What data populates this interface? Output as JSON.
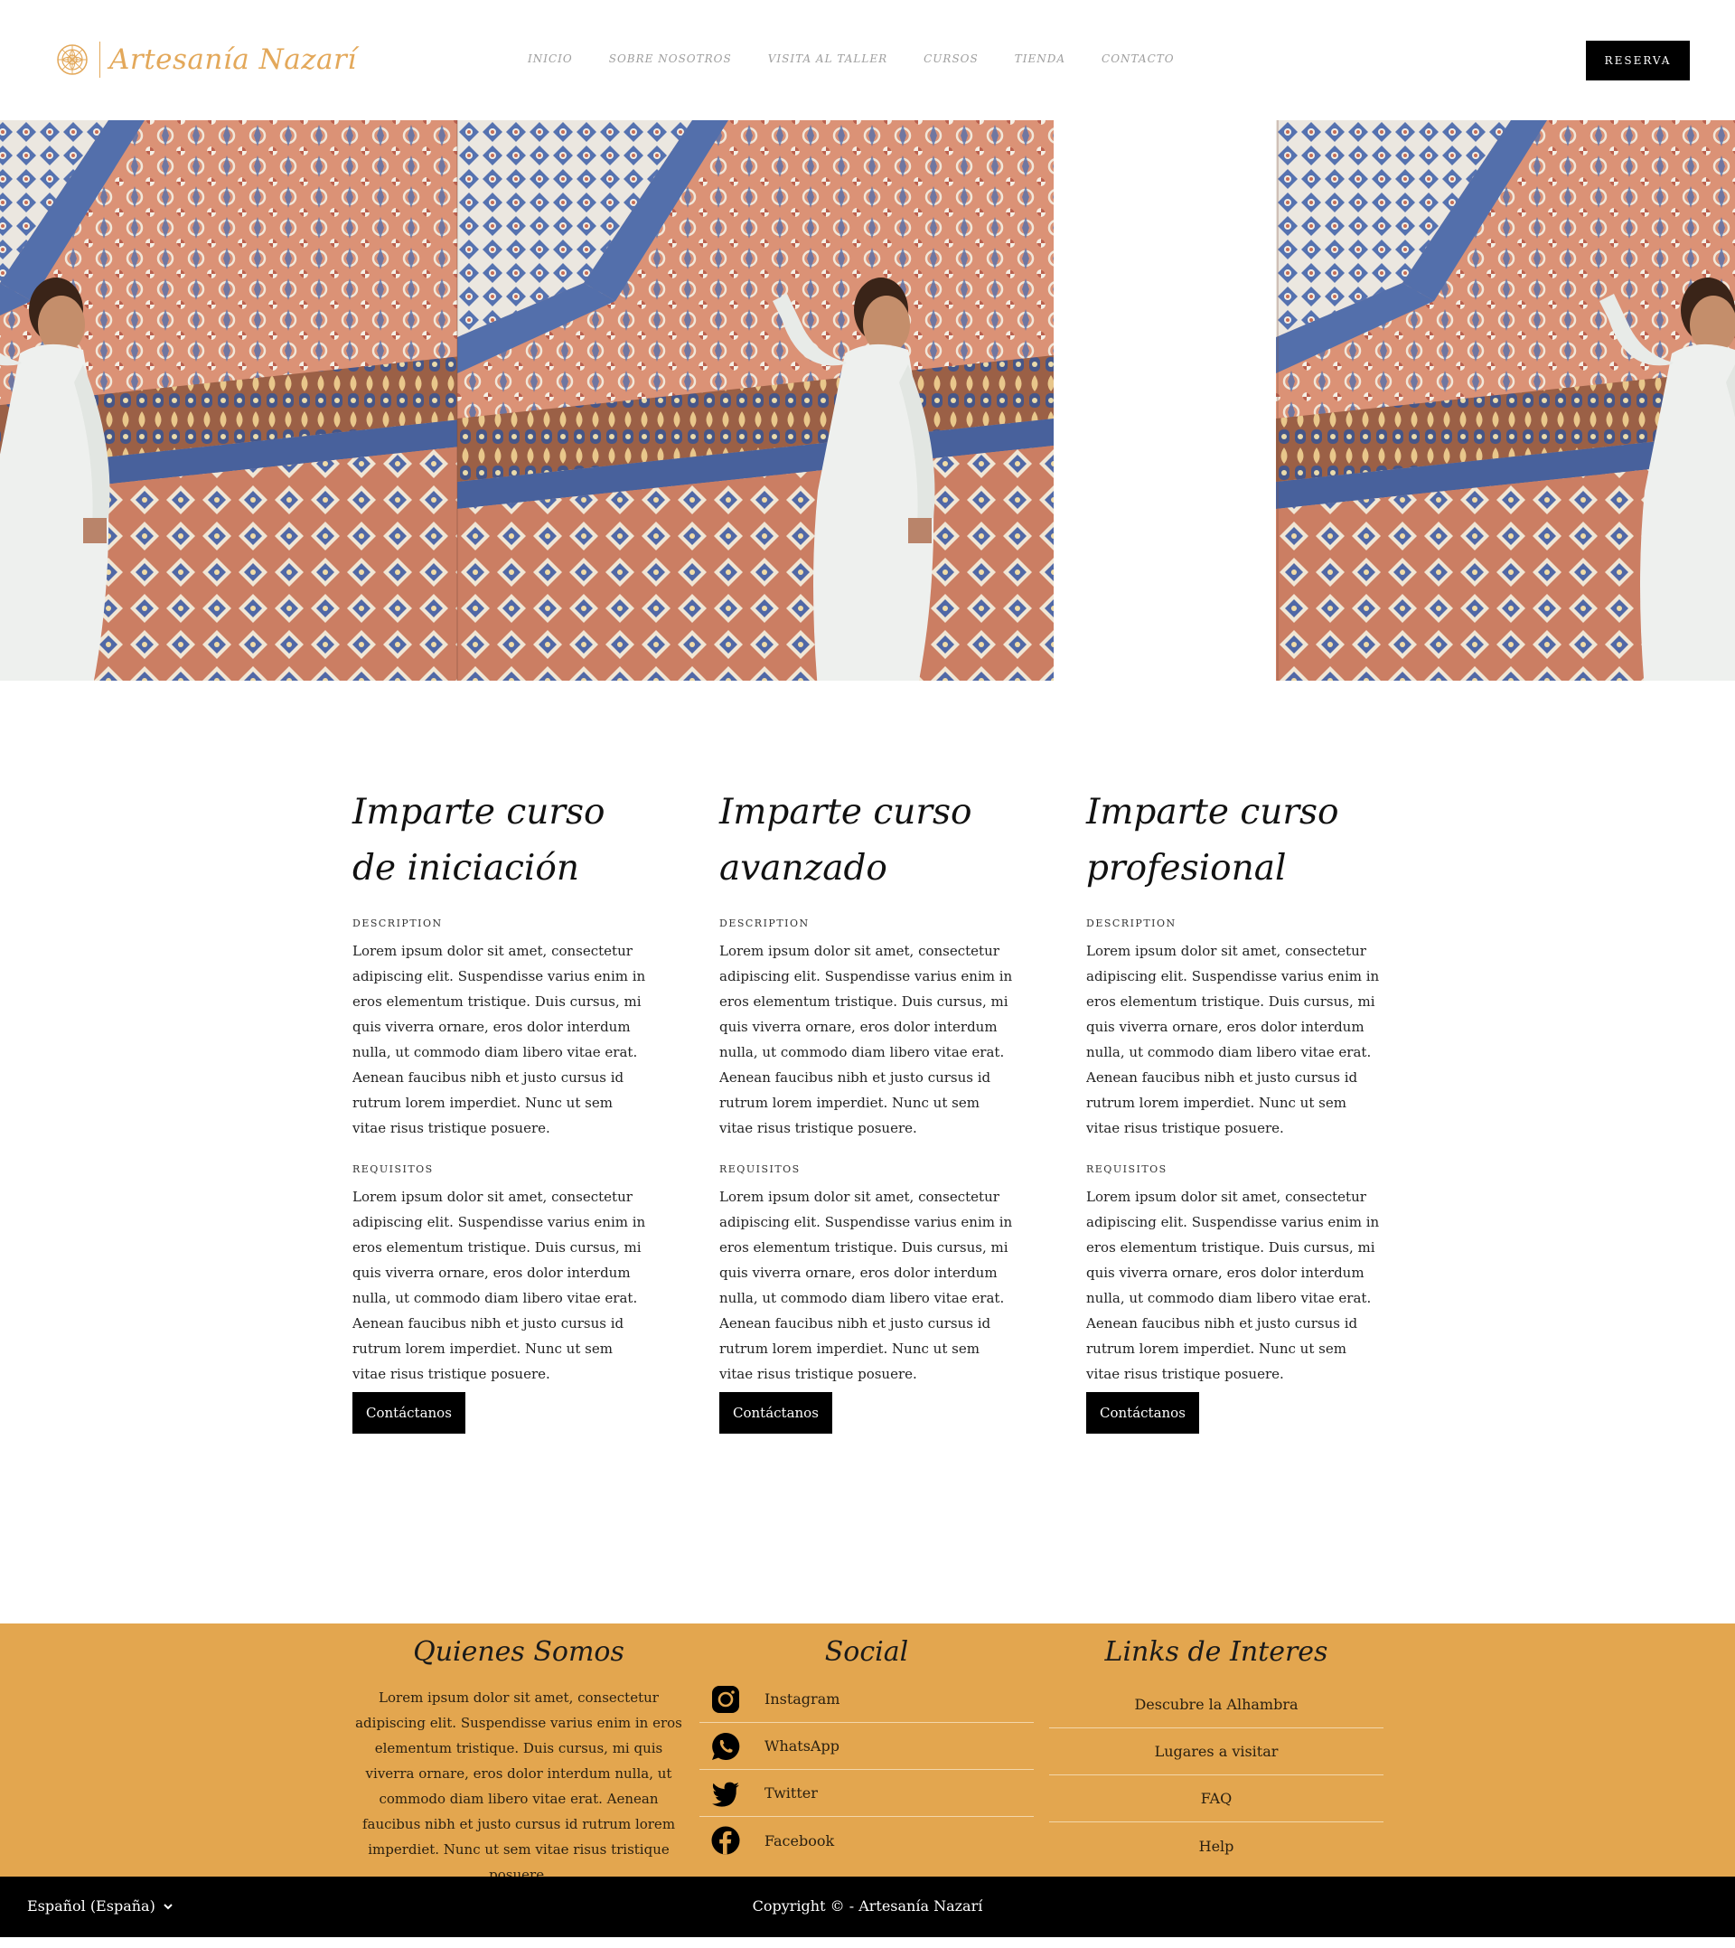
{
  "brand": {
    "name": "Artesanía Nazarí",
    "icon": "mandala-logo-icon",
    "accent": "#e3a85a"
  },
  "nav": {
    "items": [
      "INICIO",
      "SOBRE NOSOTROS",
      "VISITA AL TALLER",
      "CURSOS",
      "TIENDA",
      "CONTACTO"
    ],
    "cta": "RESERVA"
  },
  "courses": [
    {
      "title": "Imparte curso de iniciación",
      "description_label": "DESCRIPTION",
      "description": "Lorem ipsum dolor sit amet, consectetur adipiscing elit. Suspendisse varius enim in eros elementum tristique. Duis cursus, mi quis viverra ornare, eros dolor interdum nulla, ut commodo diam libero vitae erat. Aenean faucibus nibh et justo cursus id rutrum lorem imperdiet. Nunc ut sem vitae risus tristique posuere.",
      "requirements_label": "REQUISITOS",
      "requirements": "Lorem ipsum dolor sit amet, consectetur adipiscing elit. Suspendisse varius enim in eros elementum tristique. Duis cursus, mi quis viverra ornare, eros dolor interdum nulla, ut commodo diam libero vitae erat. Aenean faucibus nibh et justo cursus id rutrum lorem imperdiet. Nunc ut sem vitae risus tristique posuere.",
      "button": "Contáctanos"
    },
    {
      "title": "Imparte curso avanzado",
      "description_label": "DESCRIPTION",
      "description": "Lorem ipsum dolor sit amet, consectetur adipiscing elit. Suspendisse varius enim in eros elementum tristique. Duis cursus, mi quis viverra ornare, eros dolor interdum nulla, ut commodo diam libero vitae erat. Aenean faucibus nibh et justo cursus id rutrum lorem imperdiet. Nunc ut sem vitae risus tristique posuere.",
      "requirements_label": "REQUISITOS",
      "requirements": "Lorem ipsum dolor sit amet, consectetur adipiscing elit. Suspendisse varius enim in eros elementum tristique. Duis cursus, mi quis viverra ornare, eros dolor interdum nulla, ut commodo diam libero vitae erat. Aenean faucibus nibh et justo cursus id rutrum lorem imperdiet. Nunc ut sem vitae risus tristique posuere.",
      "button": "Contáctanos"
    },
    {
      "title": "Imparte curso profesional",
      "description_label": "DESCRIPTION",
      "description": "Lorem ipsum dolor sit amet, consectetur adipiscing elit. Suspendisse varius enim in eros elementum tristique. Duis cursus, mi quis viverra ornare, eros dolor interdum nulla, ut commodo diam libero vitae erat. Aenean faucibus nibh et justo cursus id rutrum lorem imperdiet. Nunc ut sem vitae risus tristique posuere.",
      "requirements_label": "REQUISITOS",
      "requirements": "Lorem ipsum dolor sit amet, consectetur adipiscing elit. Suspendisse varius enim in eros elementum tristique. Duis cursus, mi quis viverra ornare, eros dolor interdum nulla, ut commodo diam libero vitae erat. Aenean faucibus nibh et justo cursus id rutrum lorem imperdiet. Nunc ut sem vitae risus tristique posuere.",
      "button": "Contáctanos"
    }
  ],
  "footer": {
    "about": {
      "title": "Quienes Somos",
      "text": "Lorem ipsum dolor sit amet, consectetur adipiscing elit. Suspendisse varius enim in eros elementum tristique. Duis cursus, mi quis viverra ornare, eros dolor interdum nulla, ut commodo diam libero vitae erat. Aenean faucibus nibh et justo cursus id rutrum lorem imperdiet. Nunc ut sem vitae risus tristique posuere."
    },
    "social": {
      "title": "Social",
      "items": [
        {
          "label": "Instagram",
          "icon": "instagram-icon"
        },
        {
          "label": "WhatsApp",
          "icon": "whatsapp-icon"
        },
        {
          "label": "Twitter",
          "icon": "twitter-icon"
        },
        {
          "label": "Facebook",
          "icon": "facebook-icon"
        }
      ]
    },
    "links": {
      "title": "Links de Interes",
      "items": [
        "Descubre la Alhambra",
        "Lugares a visitar",
        "FAQ",
        "Help"
      ]
    },
    "bg_color": "#e3a64f"
  },
  "bottom": {
    "language": "Español (España)",
    "copyright": "Copyright © - Artesanía Nazarí"
  }
}
